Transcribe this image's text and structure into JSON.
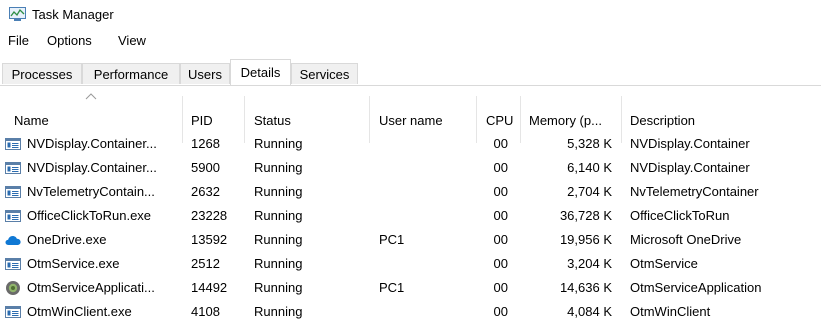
{
  "window": {
    "title": "Task Manager"
  },
  "menu": [
    "File",
    "Options",
    "View"
  ],
  "tabs": [
    "Processes",
    "Performance",
    "Users",
    "Details",
    "Services"
  ],
  "active_tab": "Details",
  "columns": {
    "name": "Name",
    "pid": "PID",
    "status": "Status",
    "user": "User name",
    "cpu": "CPU",
    "memory": "Memory (p...",
    "description": "Description"
  },
  "rows": [
    {
      "icon": "app-window-icon",
      "name": "NVDisplay.Container...",
      "pid": "1268",
      "status": "Running",
      "user": "",
      "cpu": "00",
      "memory": "5,328 K",
      "description": "NVDisplay.Container"
    },
    {
      "icon": "app-window-icon",
      "name": "NVDisplay.Container...",
      "pid": "5900",
      "status": "Running",
      "user": "",
      "cpu": "00",
      "memory": "6,140 K",
      "description": "NVDisplay.Container"
    },
    {
      "icon": "app-window-icon",
      "name": "NvTelemetryContain...",
      "pid": "2632",
      "status": "Running",
      "user": "",
      "cpu": "00",
      "memory": "2,704 K",
      "description": "NvTelemetryContainer"
    },
    {
      "icon": "app-window-icon",
      "name": "OfficeClickToRun.exe",
      "pid": "23228",
      "status": "Running",
      "user": "",
      "cpu": "00",
      "memory": "36,728 K",
      "description": "OfficeClickToRun"
    },
    {
      "icon": "onedrive-cloud-icon",
      "name": "OneDrive.exe",
      "pid": "13592",
      "status": "Running",
      "user": "PC1",
      "cpu": "00",
      "memory": "19,956 K",
      "description": "Microsoft OneDrive"
    },
    {
      "icon": "app-window-icon",
      "name": "OtmService.exe",
      "pid": "2512",
      "status": "Running",
      "user": "",
      "cpu": "00",
      "memory": "3,204 K",
      "description": "OtmService"
    },
    {
      "icon": "otm-gear-icon",
      "name": "OtmServiceApplicati...",
      "pid": "14492",
      "status": "Running",
      "user": "PC1",
      "cpu": "00",
      "memory": "14,636 K",
      "description": "OtmServiceApplication"
    },
    {
      "icon": "app-window-icon",
      "name": "OtmWinClient.exe",
      "pid": "4108",
      "status": "Running",
      "user": "",
      "cpu": "00",
      "memory": "4,084 K",
      "description": "OtmWinClient"
    }
  ],
  "colors": {
    "tab_border": "#d9d9d9",
    "icon_blue": "#2b6cb0",
    "onedrive_blue": "#0f78d4"
  }
}
